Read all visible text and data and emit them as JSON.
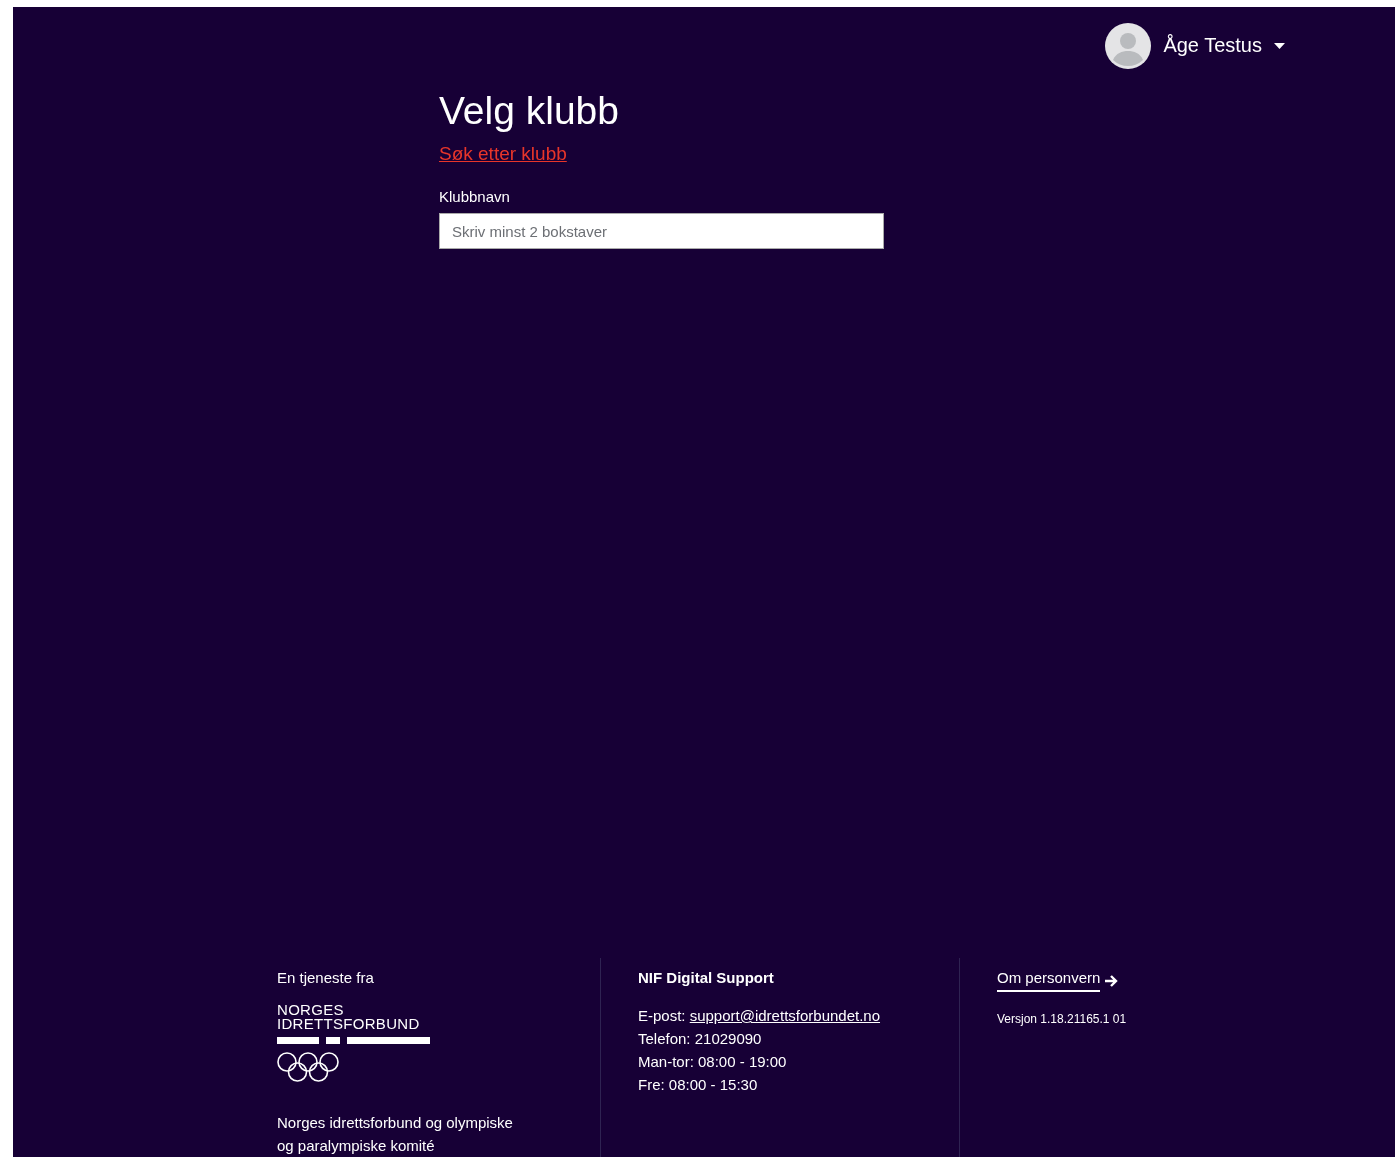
{
  "user_menu": {
    "name": "Åge Testus"
  },
  "page": {
    "title": "Velg klubb",
    "search_link": "Søk etter klubb",
    "field": {
      "label": "Klubbnavn",
      "placeholder": "Skriv minst 2 bokstaver"
    }
  },
  "footer": {
    "provider": {
      "heading": "En tjeneste fra",
      "logo_lines": [
        "NORGES",
        "IDRETTSFORBUND"
      ],
      "org_name": "Norges idrettsforbund og olympiske og paralympiske komité"
    },
    "support": {
      "heading": "NIF Digital Support",
      "email_label": "E-post:",
      "email": "support@idrettsforbundet.no",
      "lines": [
        "Telefon: 21029090",
        "Man-tor: 08:00 - 19:00",
        "Fre: 08:00 - 15:30"
      ]
    },
    "privacy": {
      "link": "Om personvern",
      "version": "Versjon 1.18.21165.1 01"
    }
  }
}
